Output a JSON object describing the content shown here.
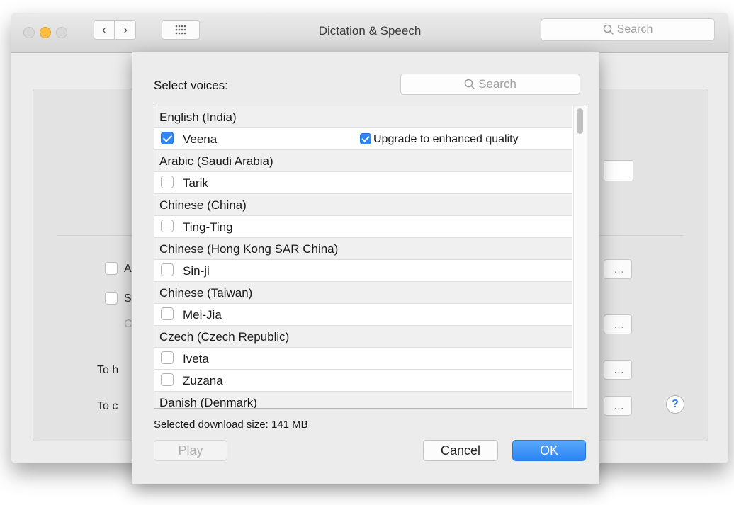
{
  "window": {
    "title": "Dictation & Speech",
    "search_placeholder": "Search",
    "back_icon": "‹",
    "forward_icon": "›",
    "grid_icon": "⋮⋮⋮",
    "background": {
      "check_a_partial": "A",
      "check_s_partial": "S",
      "option_partial": "C",
      "to_h_partial": "To h",
      "to_c_partial": "To c",
      "dots": "…",
      "help": "?"
    }
  },
  "sheet": {
    "label": "Select voices:",
    "search_placeholder": "Search",
    "list": [
      {
        "type": "group",
        "text": "English (India)"
      },
      {
        "type": "voice",
        "text": "Veena",
        "checked": true,
        "enhanced": {
          "label": "Upgrade to enhanced quality",
          "checked": true
        }
      },
      {
        "type": "group",
        "text": "Arabic (Saudi Arabia)"
      },
      {
        "type": "voice",
        "text": "Tarik",
        "checked": false
      },
      {
        "type": "group",
        "text": "Chinese (China)"
      },
      {
        "type": "voice",
        "text": "Ting-Ting",
        "checked": false
      },
      {
        "type": "group",
        "text": "Chinese (Hong Kong SAR China)"
      },
      {
        "type": "voice",
        "text": "Sin-ji",
        "checked": false
      },
      {
        "type": "group",
        "text": "Chinese (Taiwan)"
      },
      {
        "type": "voice",
        "text": "Mei-Jia",
        "checked": false
      },
      {
        "type": "group",
        "text": "Czech (Czech Republic)"
      },
      {
        "type": "voice",
        "text": "Iveta",
        "checked": false
      },
      {
        "type": "voice",
        "text": "Zuzana",
        "checked": false
      },
      {
        "type": "group",
        "text": "Danish (Denmark)"
      }
    ],
    "download_size": "Selected download size: 141 MB",
    "buttons": {
      "play": "Play",
      "cancel": "Cancel",
      "ok": "OK"
    }
  }
}
